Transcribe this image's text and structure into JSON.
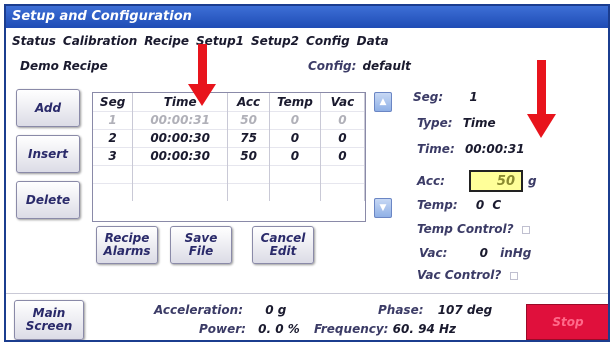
{
  "window": {
    "title": "Setup and Configuration"
  },
  "tabs": [
    "Status",
    "Calibration",
    "Recipe",
    "Setup1",
    "Setup2",
    "Config",
    "Data"
  ],
  "recipe": {
    "name": "Demo Recipe",
    "config_label": "Config:",
    "config_value": "default"
  },
  "buttons": {
    "add": "Add",
    "insert": "Insert",
    "delete": "Delete",
    "recipe_alarms": [
      "Recipe",
      "Alarms"
    ],
    "save_file": [
      "Save",
      "File"
    ],
    "cancel_edit": [
      "Cancel",
      "Edit"
    ],
    "main_screen": [
      "Main",
      "Screen"
    ],
    "stop": "Stop"
  },
  "table": {
    "headers": [
      "Seg",
      "Time",
      "Acc",
      "Temp",
      "Vac"
    ],
    "rows": [
      {
        "seg": "1",
        "time": "00:00:31",
        "acc": "50",
        "temp": "0",
        "vac": "0",
        "dim": true
      },
      {
        "seg": "2",
        "time": "00:00:30",
        "acc": "75",
        "temp": "0",
        "vac": "0",
        "dim": false
      },
      {
        "seg": "3",
        "time": "00:00:30",
        "acc": "50",
        "temp": "0",
        "vac": "0",
        "dim": false
      }
    ]
  },
  "details": {
    "seg_label": "Seg:",
    "seg_value": "1",
    "type_label": "Type:",
    "type_value": "Time",
    "time_label": "Time:",
    "time_value": "00:00:31",
    "acc_label": "Acc:",
    "acc_value": "50",
    "acc_unit": "g",
    "temp_label": "Temp:",
    "temp_value": "0",
    "temp_unit": "C",
    "temp_control_label": "Temp Control?",
    "vac_label": "Vac:",
    "vac_value": "0",
    "vac_unit": "inHg",
    "vac_control_label": "Vac Control?"
  },
  "status": {
    "acceleration_label": "Acceleration:",
    "acceleration_value": "0 g",
    "power_label": "Power:",
    "power_value": "0. 0 %",
    "phase_label": "Phase:",
    "phase_value": "107 deg",
    "frequency_label": "Frequency:",
    "frequency_value": "60. 94 Hz"
  },
  "colors": {
    "title_bar": "#2a5bc4",
    "acc_highlight": "#ffff99",
    "stop": "#e0103c",
    "annotation_arrow": "#e8141c"
  },
  "icons": [
    "up-arrow-icon",
    "down-arrow-icon",
    "checkbox-icon",
    "annotation-arrow-icon"
  ]
}
